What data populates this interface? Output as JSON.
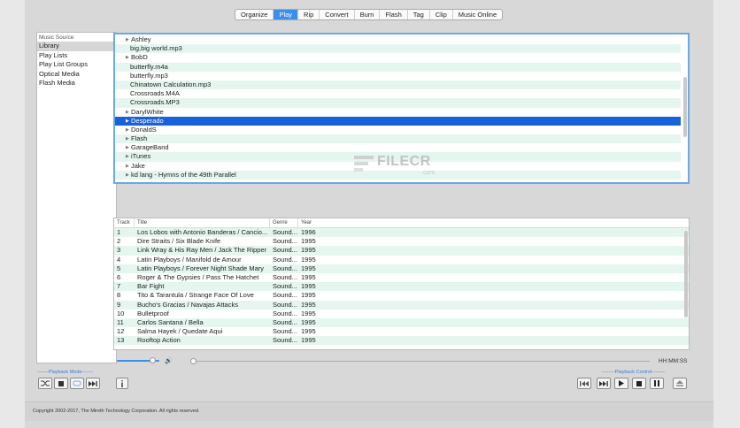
{
  "tabs": [
    {
      "label": "Organize",
      "active": false
    },
    {
      "label": "Play",
      "active": true
    },
    {
      "label": "Rip",
      "active": false
    },
    {
      "label": "Convert",
      "active": false
    },
    {
      "label": "Burn",
      "active": false
    },
    {
      "label": "Flash",
      "active": false
    },
    {
      "label": "Tag",
      "active": false
    },
    {
      "label": "Clip",
      "active": false
    },
    {
      "label": "Music Online",
      "active": false
    }
  ],
  "source": {
    "header": "Music Source",
    "items": [
      {
        "label": "Library",
        "selected": true
      },
      {
        "label": "Play Lists",
        "selected": false
      },
      {
        "label": "Play List Groups",
        "selected": false
      },
      {
        "label": "Optical Media",
        "selected": false
      },
      {
        "label": "Flash Media",
        "selected": false
      }
    ]
  },
  "browser": {
    "rows": [
      {
        "label": "Ashley",
        "folder": true,
        "selected": false
      },
      {
        "label": "big,big world.mp3",
        "folder": false,
        "selected": false
      },
      {
        "label": "BobD",
        "folder": true,
        "selected": false
      },
      {
        "label": "butterfly.m4a",
        "folder": false,
        "selected": false
      },
      {
        "label": "butterfly.mp3",
        "folder": false,
        "selected": false
      },
      {
        "label": "Chinatown Calculation.mp3",
        "folder": false,
        "selected": false
      },
      {
        "label": "Crossroads.M4A",
        "folder": false,
        "selected": false
      },
      {
        "label": "Crossroads.MP3",
        "folder": false,
        "selected": false
      },
      {
        "label": "DarylWhite",
        "folder": true,
        "selected": false
      },
      {
        "label": "Desperado",
        "folder": true,
        "selected": true
      },
      {
        "label": "DonaldS",
        "folder": true,
        "selected": false
      },
      {
        "label": "Flash",
        "folder": true,
        "selected": false
      },
      {
        "label": "GarageBand",
        "folder": true,
        "selected": false
      },
      {
        "label": "iTunes",
        "folder": true,
        "selected": false
      },
      {
        "label": "Jake",
        "folder": true,
        "selected": false
      },
      {
        "label": "kd lang - Hymns of the 49th Parallel",
        "folder": true,
        "selected": false
      }
    ]
  },
  "watermark": {
    "text": "FILECR",
    "sub": ".com"
  },
  "tracks": {
    "headers": {
      "track": "Track",
      "title": "Title",
      "genre": "Genre",
      "year": "Year"
    },
    "rows": [
      {
        "track": "1",
        "title": "Los Lobos with Antonio Banderas / Cancio...",
        "genre": "Sound...",
        "year": "1996"
      },
      {
        "track": "2",
        "title": "Dire Straits / Six Blade Knife",
        "genre": "Sound...",
        "year": "1995"
      },
      {
        "track": "3",
        "title": "Link Wray & His Ray Men / Jack The Ripper",
        "genre": "Sound...",
        "year": "1995"
      },
      {
        "track": "4",
        "title": "Latin Playboys / Manifold de Amour",
        "genre": "Sound...",
        "year": "1995"
      },
      {
        "track": "5",
        "title": "Latin Playboys / Forever Night Shade Mary",
        "genre": "Sound...",
        "year": "1995"
      },
      {
        "track": "6",
        "title": "Roger & The Gypsies / Pass The Hatchet",
        "genre": "Sound...",
        "year": "1995"
      },
      {
        "track": "7",
        "title": "Bar Fight",
        "genre": "Sound...",
        "year": "1995"
      },
      {
        "track": "8",
        "title": "Tito & Tarantula / Strange Face Of Love",
        "genre": "Sound...",
        "year": "1995"
      },
      {
        "track": "9",
        "title": "Bucho's Gracias / Navajas Attacks",
        "genre": "Sound...",
        "year": "1995"
      },
      {
        "track": "10",
        "title": "Bulletproof",
        "genre": "Sound...",
        "year": "1995"
      },
      {
        "track": "11",
        "title": "Carlos Santana / Bella",
        "genre": "Sound...",
        "year": "1995"
      },
      {
        "track": "12",
        "title": "Salma Hayek / Quedate Aqui",
        "genre": "Sound...",
        "year": "1995"
      },
      {
        "track": "13",
        "title": "Rooftop Action",
        "genre": "Sound...",
        "year": "1995"
      }
    ]
  },
  "player": {
    "time": "HH:MM:SS",
    "volume_level": 0.85,
    "position_level": 0.0,
    "playback_mode_label": "Playback Mode",
    "playback_control_label": "Playback Control"
  },
  "colors": {
    "accent": "#3b8eea",
    "selection": "#1762d8",
    "row_alt": "#e4f6ee",
    "group_label": "#3b7bd6"
  },
  "icons": {
    "mode_buttons": [
      "shuffle-icon",
      "stop-mode-icon",
      "repeat-icon",
      "next-track-mode-icon"
    ],
    "info_button": "info-icon",
    "control_buttons": [
      "previous-icon",
      "next-icon",
      "play-icon",
      "stop-icon",
      "pause-icon",
      "eject-icon"
    ]
  },
  "footer": {
    "copyright": "Copyright 2002-2017, The Mireth Technology Corporation. All rights reserved."
  }
}
